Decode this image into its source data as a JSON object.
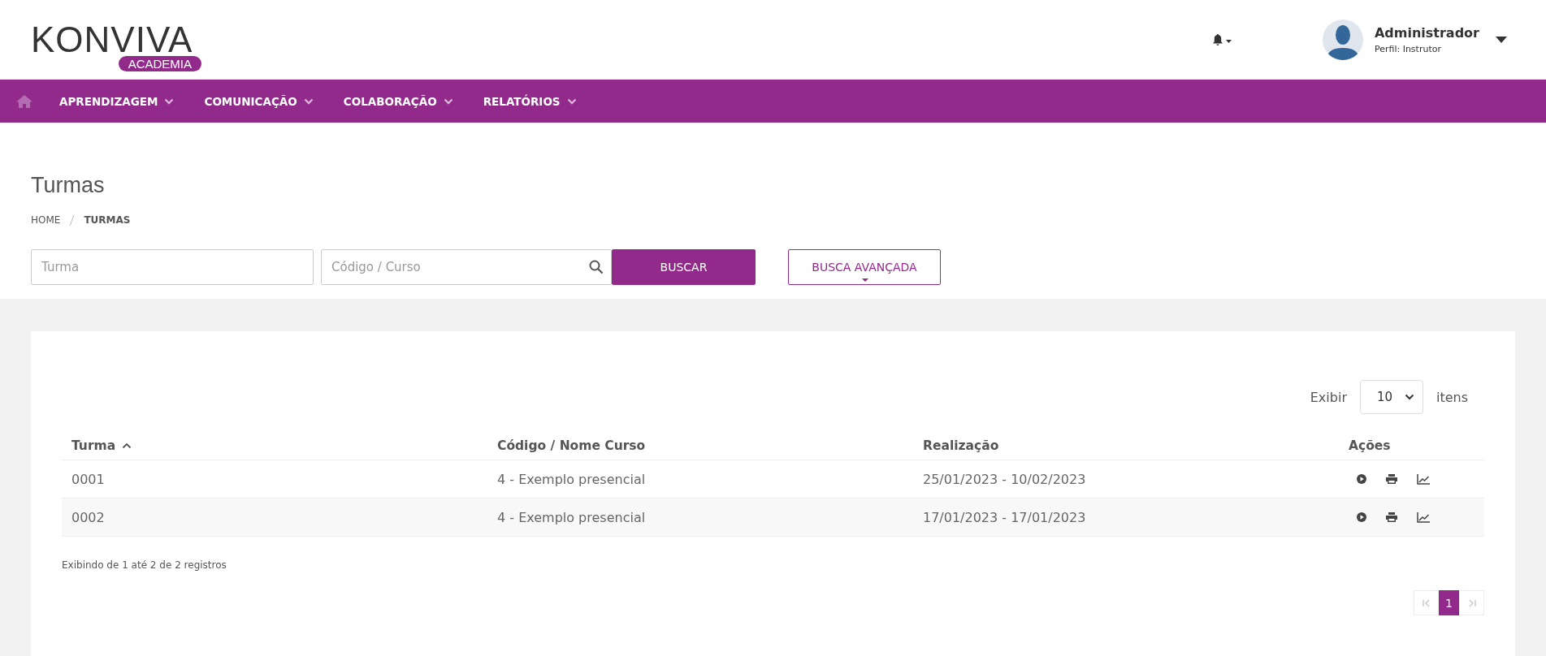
{
  "logo": {
    "name": "KONVIVA",
    "tag": "ACADEMIA"
  },
  "user": {
    "name": "Administrador",
    "profile": "Perfil: Instrutor"
  },
  "nav": {
    "items": [
      {
        "label": "APRENDIZAGEM"
      },
      {
        "label": "COMUNICAÇÃO"
      },
      {
        "label": "COLABORAÇÃO"
      },
      {
        "label": "RELATÓRIOS"
      }
    ]
  },
  "page": {
    "title": "Turmas",
    "breadcrumb": [
      {
        "label": "HOME",
        "current": false
      },
      {
        "label": "TURMAS",
        "current": true
      }
    ]
  },
  "search": {
    "turma_placeholder": "Turma",
    "curso_placeholder": "Código / Curso",
    "search_button": "BUSCAR",
    "advanced_button": "BUSCA AVANÇADA"
  },
  "page_size": {
    "label": "Exibir",
    "value": "10",
    "suffix": "itens"
  },
  "table": {
    "columns": [
      {
        "label": "Turma",
        "sorted": true
      },
      {
        "label": "Código / Nome Curso",
        "sorted": false
      },
      {
        "label": "Realização",
        "sorted": false
      },
      {
        "label": "Ações",
        "sorted": false
      }
    ],
    "rows": [
      {
        "turma": "0001",
        "curso": "4 - Exemplo presencial",
        "realizacao": "25/01/2023 - 10/02/2023"
      },
      {
        "turma": "0002",
        "curso": "4 - Exemplo presencial",
        "realizacao": "17/01/2023 - 17/01/2023"
      }
    ]
  },
  "summary": "Exibindo de 1 até 2 de 2 registros",
  "pagination": {
    "pages": [
      {
        "label": "1",
        "selected": true
      }
    ]
  }
}
